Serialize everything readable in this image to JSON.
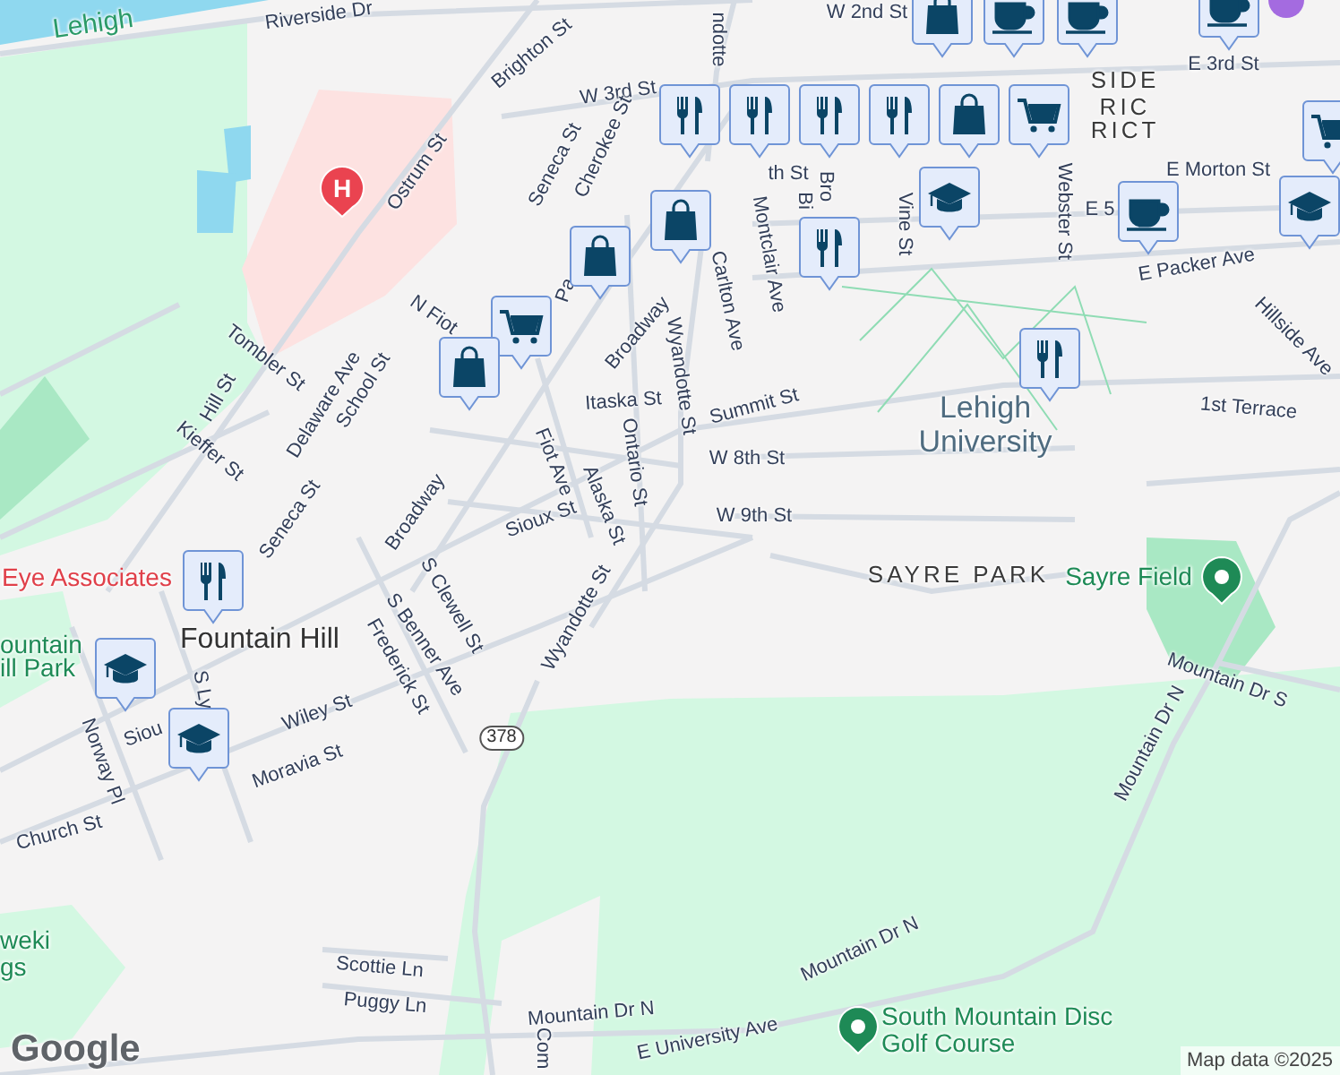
{
  "map": {
    "labels": [
      {
        "text": "Lehigh",
        "kind": "water"
      },
      {
        "text": "Riverside Dr",
        "kind": "street"
      },
      {
        "text": "W 2nd St",
        "kind": "street"
      },
      {
        "text": "ndotte",
        "kind": "street"
      },
      {
        "text": "E 3rd St",
        "kind": "street"
      },
      {
        "text": "Brighton St",
        "kind": "street"
      },
      {
        "text": "W 3rd St",
        "kind": "street"
      },
      {
        "text": "SIDE",
        "kind": "district"
      },
      {
        "text": "RIC",
        "kind": "district"
      },
      {
        "text": "RICT",
        "kind": "district"
      },
      {
        "text": "Seneca St",
        "kind": "street"
      },
      {
        "text": "Cherokee St",
        "kind": "street"
      },
      {
        "text": "th St",
        "kind": "street"
      },
      {
        "text": "Ostrum St",
        "kind": "street"
      },
      {
        "text": "E Morton St",
        "kind": "street"
      },
      {
        "text": "Bi",
        "kind": "street"
      },
      {
        "text": "Bro",
        "kind": "street"
      },
      {
        "text": "E 5",
        "kind": "street"
      },
      {
        "text": "Vine St",
        "kind": "street"
      },
      {
        "text": "Webster St",
        "kind": "street"
      },
      {
        "text": "Carlton Ave",
        "kind": "street"
      },
      {
        "text": "Montclair Ave",
        "kind": "street"
      },
      {
        "text": "E Packer Ave",
        "kind": "street"
      },
      {
        "text": "N Fiot",
        "kind": "street"
      },
      {
        "text": "Pa",
        "kind": "street"
      },
      {
        "text": "Broadway",
        "kind": "street"
      },
      {
        "text": "Wyandotte St",
        "kind": "street"
      },
      {
        "text": "Hillside Ave",
        "kind": "street"
      },
      {
        "text": "Tombler St",
        "kind": "street"
      },
      {
        "text": "Delaware Ave",
        "kind": "street"
      },
      {
        "text": "School St",
        "kind": "street"
      },
      {
        "text": "Hill St",
        "kind": "street"
      },
      {
        "text": "Kieffer St",
        "kind": "street"
      },
      {
        "text": "Itaska St",
        "kind": "street"
      },
      {
        "text": "Summit St",
        "kind": "street"
      },
      {
        "text": "1st Terrace",
        "kind": "street"
      },
      {
        "text": "Lehigh University",
        "kind": "campus"
      },
      {
        "text": "W 8th St",
        "kind": "street"
      },
      {
        "text": "Fiot Ave",
        "kind": "street"
      },
      {
        "text": "Ontario St",
        "kind": "street"
      },
      {
        "text": "Alaska St",
        "kind": "street"
      },
      {
        "text": "Broadway",
        "kind": "street"
      },
      {
        "text": "Seneca St",
        "kind": "street"
      },
      {
        "text": "Sioux St",
        "kind": "street"
      },
      {
        "text": "W 9th St",
        "kind": "street"
      },
      {
        "text": "Eye Associates",
        "kind": "medical"
      },
      {
        "text": "SAYRE PARK",
        "kind": "district"
      },
      {
        "text": "Sayre Field",
        "kind": "park"
      },
      {
        "text": "Wyandotte St",
        "kind": "street"
      },
      {
        "text": "S Clewell St",
        "kind": "street"
      },
      {
        "text": "Fountain Hill",
        "kind": "town"
      },
      {
        "text": "ountain",
        "kind": "park"
      },
      {
        "text": "ill Park",
        "kind": "park"
      },
      {
        "text": "S Benner Ave",
        "kind": "street"
      },
      {
        "text": "Mountain Dr S",
        "kind": "street"
      },
      {
        "text": "S Ly",
        "kind": "street"
      },
      {
        "text": "Frederick St",
        "kind": "street"
      },
      {
        "text": "Wiley St",
        "kind": "street"
      },
      {
        "text": "Siou",
        "kind": "street"
      },
      {
        "text": "378",
        "kind": "route"
      },
      {
        "text": "Mountain Dr N",
        "kind": "street"
      },
      {
        "text": "Norway Pl",
        "kind": "street"
      },
      {
        "text": "Moravia St",
        "kind": "street"
      },
      {
        "text": "Church St",
        "kind": "street"
      },
      {
        "text": "Mountain Dr N",
        "kind": "street"
      },
      {
        "text": "weki",
        "kind": "park"
      },
      {
        "text": "gs",
        "kind": "park"
      },
      {
        "text": "Scottie Ln",
        "kind": "street"
      },
      {
        "text": "Puggy Ln",
        "kind": "street"
      },
      {
        "text": "Mountain Dr N",
        "kind": "street"
      },
      {
        "text": "Com",
        "kind": "street"
      },
      {
        "text": "E University Ave",
        "kind": "street"
      },
      {
        "text": "South Mountain Disc Golf Course",
        "kind": "park"
      }
    ],
    "markers": [
      {
        "kind": "shopping"
      },
      {
        "kind": "cafe"
      },
      {
        "kind": "cafe"
      },
      {
        "kind": "cafe"
      },
      {
        "kind": "generic"
      },
      {
        "kind": "restaurant"
      },
      {
        "kind": "restaurant"
      },
      {
        "kind": "restaurant"
      },
      {
        "kind": "restaurant"
      },
      {
        "kind": "shopping"
      },
      {
        "kind": "cart"
      },
      {
        "kind": "cart"
      },
      {
        "kind": "hospital",
        "label": "H"
      },
      {
        "kind": "school"
      },
      {
        "kind": "shopping"
      },
      {
        "kind": "restaurant"
      },
      {
        "kind": "cafe"
      },
      {
        "kind": "school"
      },
      {
        "kind": "shopping"
      },
      {
        "kind": "cart"
      },
      {
        "kind": "shopping"
      },
      {
        "kind": "restaurant"
      },
      {
        "kind": "restaurant"
      },
      {
        "kind": "park"
      },
      {
        "kind": "school"
      },
      {
        "kind": "school"
      },
      {
        "kind": "park"
      }
    ],
    "logo": "Google",
    "attribution": "Map data ©2025"
  }
}
